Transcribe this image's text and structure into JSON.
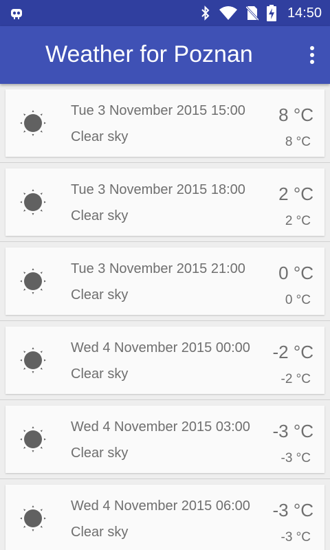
{
  "status_bar": {
    "time": "14:50",
    "icons": [
      "robot-icon",
      "bluetooth-icon",
      "wifi-icon",
      "no-sim-icon",
      "battery-charging-icon"
    ]
  },
  "app_bar": {
    "title": "Weather for Poznan",
    "overflow_icon": "more-vert-icon",
    "color": "#3f51b5",
    "status_color": "#303f9f"
  },
  "forecast": [
    {
      "date": "Tue 3 November 2015 15:00",
      "description": "Clear sky",
      "temp": "8 °C",
      "temp_small": "8 °C",
      "icon": "sun-icon"
    },
    {
      "date": "Tue 3 November 2015 18:00",
      "description": "Clear sky",
      "temp": "2 °C",
      "temp_small": "2 °C",
      "icon": "sun-icon"
    },
    {
      "date": "Tue 3 November 2015 21:00",
      "description": "Clear sky",
      "temp": "0 °C",
      "temp_small": "0 °C",
      "icon": "sun-icon"
    },
    {
      "date": "Wed 4 November 2015 00:00",
      "description": "Clear sky",
      "temp": "-2 °C",
      "temp_small": "-2 °C",
      "icon": "sun-icon"
    },
    {
      "date": "Wed 4 November 2015 03:00",
      "description": "Clear sky",
      "temp": "-3 °C",
      "temp_small": "-3 °C",
      "icon": "sun-icon"
    },
    {
      "date": "Wed 4 November 2015 06:00",
      "description": "Clear sky",
      "temp": "-3 °C",
      "temp_small": "-3 °C",
      "icon": "sun-icon"
    }
  ]
}
